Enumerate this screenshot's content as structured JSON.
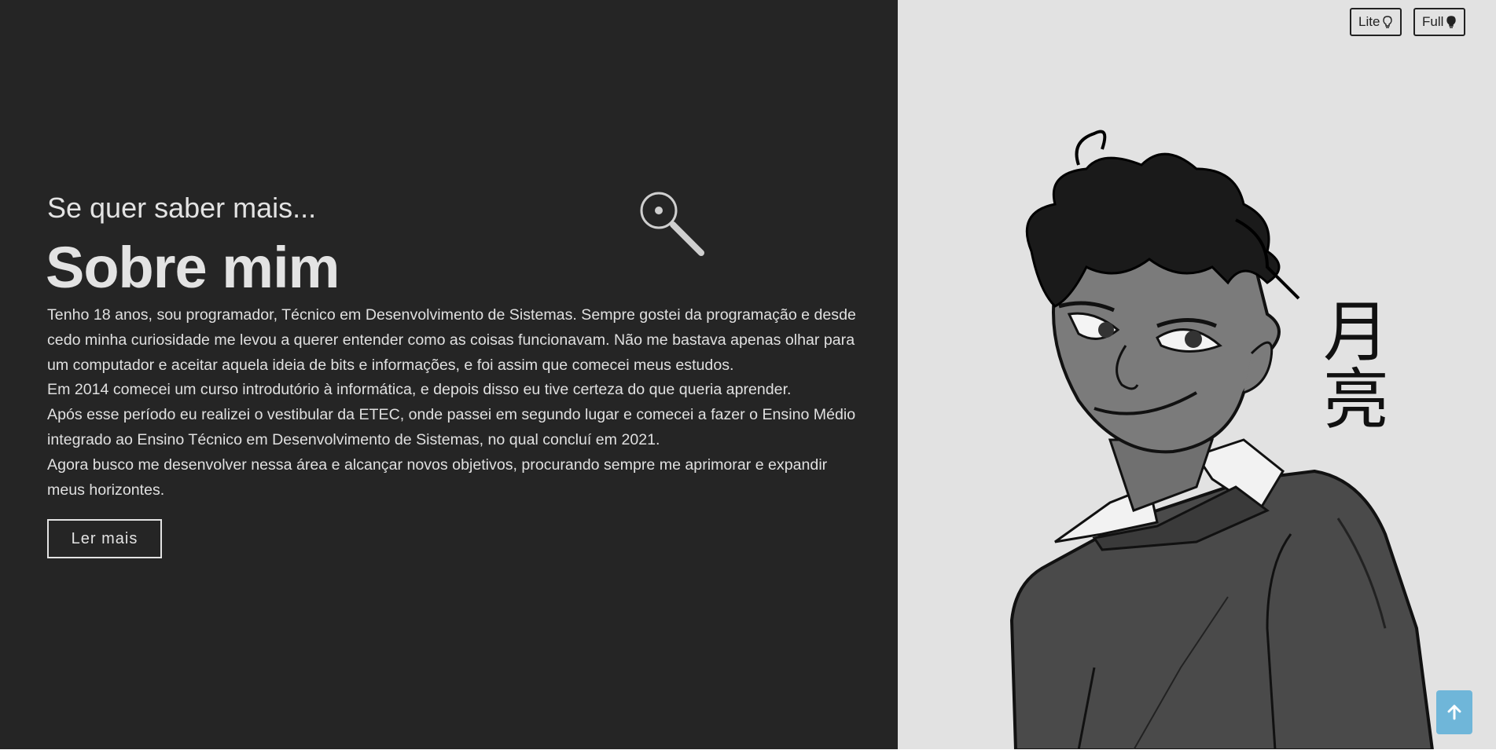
{
  "header": {
    "mode_buttons": [
      {
        "label": "Lite",
        "icon": "lightbulb-outline-icon"
      },
      {
        "label": "Full",
        "icon": "lightbulb-filled-icon"
      }
    ]
  },
  "about": {
    "subtitle": "Se quer saber mais...",
    "title": "Sobre mim",
    "decoration_icon": "magnifier-icon",
    "paragraphs": [
      "Tenho 18 anos, sou programador, Técnico em Desenvolvimento de Sistemas. Sempre gostei da programação e desde cedo minha curiosidade me levou a querer entender como as coisas funcionavam. Não me bastava apenas olhar para um computador e aceitar aquela ideia de bits e informações, e foi assim que comecei meus estudos.",
      "Em 2014 comecei um curso introdutório à informática, e depois disso eu tive certeza do que queria aprender.",
      "Após esse período eu realizei o vestibular da ETEC, onde passei em segundo lugar e comecei a fazer o Ensino Médio integrado ao Ensino Técnico em Desenvolvimento de Sistemas, no qual concluí em 2021.",
      "Agora busco me desenvolver nessa área e alcançar novos objetivos, procurando sempre me aprimorar e expandir meus horizontes."
    ],
    "read_more_label": "Ler mais"
  },
  "portrait": {
    "kanji_top": "月",
    "kanji_bottom": "亮"
  },
  "scroll_top": {
    "icon": "arrow-up-icon"
  },
  "colors": {
    "left_background": "#252525",
    "right_background": "#e2e2e2",
    "text": "#e3e3e3",
    "scroll_button": "#6fb6d9"
  }
}
